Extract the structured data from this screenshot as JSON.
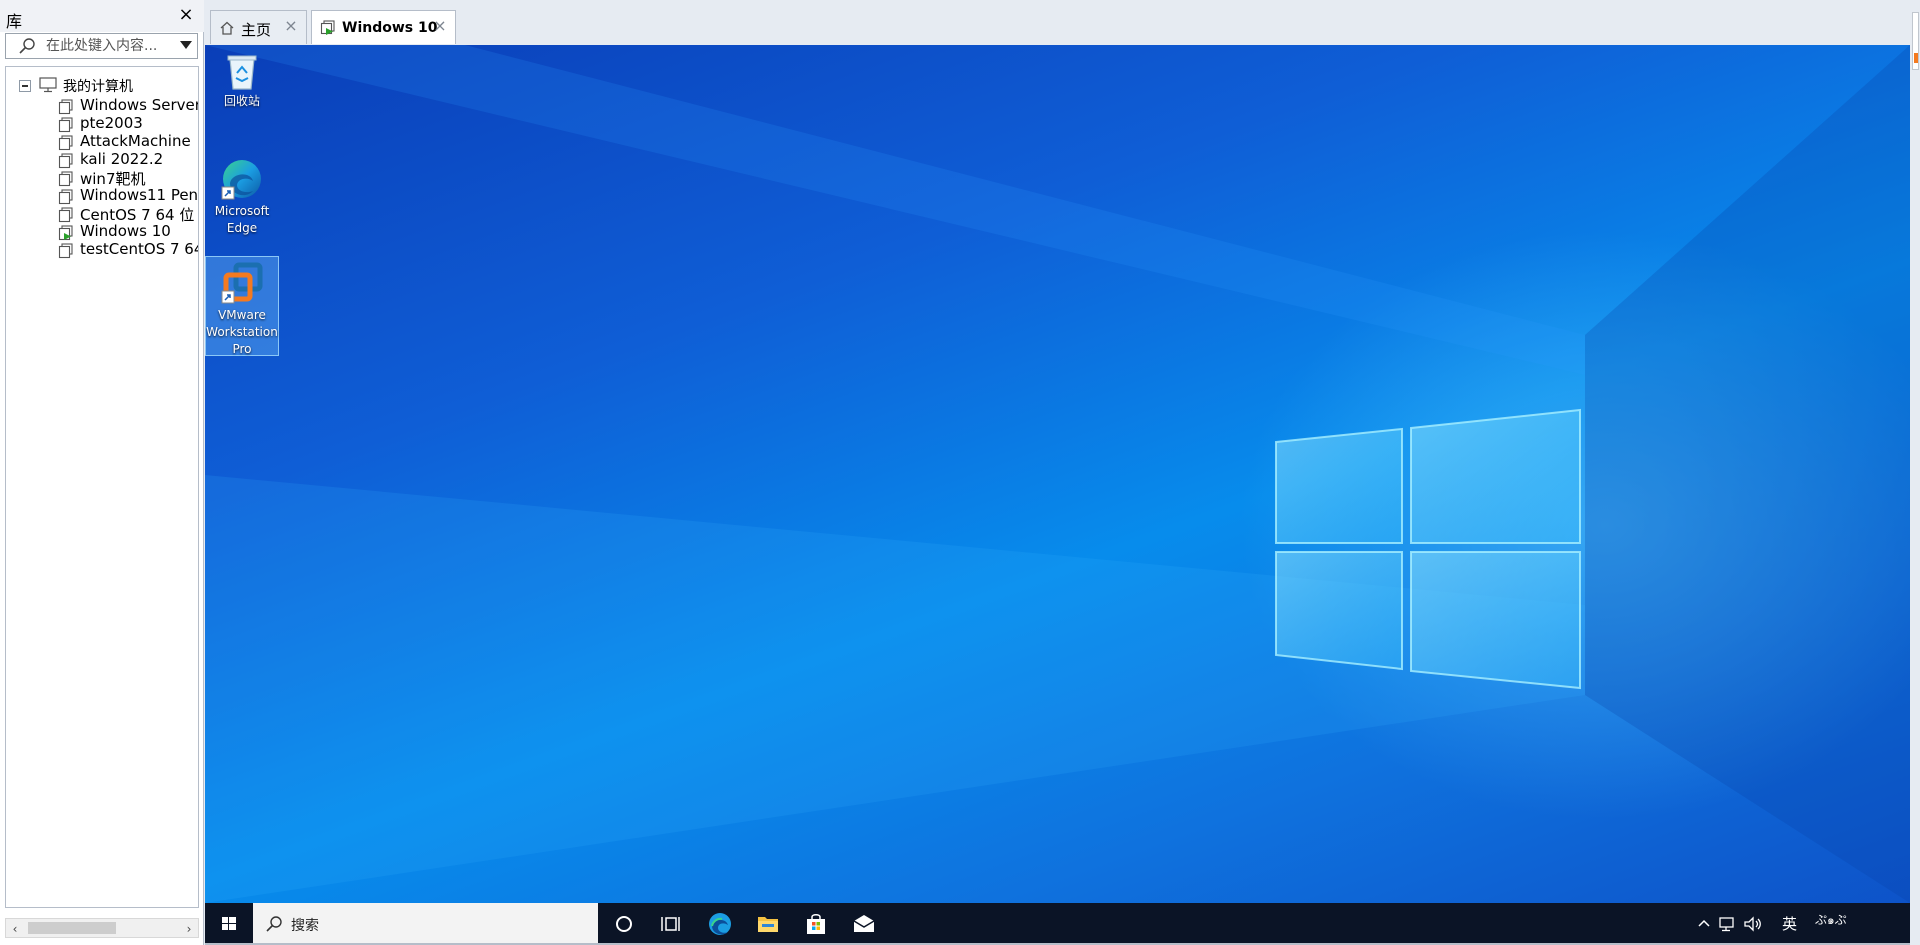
{
  "library": {
    "title": "库",
    "close_label": "×",
    "search_placeholder": "在此处键入内容...",
    "root_label": "我的计算机",
    "vms": [
      {
        "label": "Windows Server",
        "running": false
      },
      {
        "label": "pte2003",
        "running": false
      },
      {
        "label": "AttackMachine",
        "running": false
      },
      {
        "label": "kali 2022.2",
        "running": false
      },
      {
        "label": "win7靶机",
        "running": false
      },
      {
        "label": "Windows11 Pen",
        "running": false
      },
      {
        "label": "CentOS 7 64 位",
        "running": false
      },
      {
        "label": "Windows 10",
        "running": true
      },
      {
        "label": "testCentOS 7 64",
        "running": false
      }
    ],
    "scroll_left": "‹",
    "scroll_right": "›"
  },
  "tabs": [
    {
      "label": "主页",
      "icon": "home-icon",
      "active": false,
      "close": "×"
    },
    {
      "label": "Windows 10",
      "icon": "vm-running-icon",
      "active": true,
      "close": "×"
    }
  ],
  "desktop": {
    "icons": [
      {
        "name": "recycle-bin",
        "label": "回收站",
        "selected": false
      },
      {
        "name": "microsoft-edge",
        "label": "Microsoft Edge",
        "selected": false
      },
      {
        "name": "vmware-workstation-pro",
        "label": "VMware Workstation Pro",
        "selected": true
      }
    ]
  },
  "taskbar": {
    "search_label": "搜索",
    "pinned": [
      "cortana-icon",
      "task-view-icon",
      "edge-icon",
      "file-explorer-icon",
      "store-icon",
      "mail-icon"
    ],
    "tray": {
      "lang": "英",
      "clock": "ぷ๑ぷ"
    }
  },
  "colors": {
    "taskbar": "#0b1426",
    "wallpaper": "#078cec",
    "running_vm": "#2aa02a",
    "vmware_orange": "#f47a20"
  }
}
